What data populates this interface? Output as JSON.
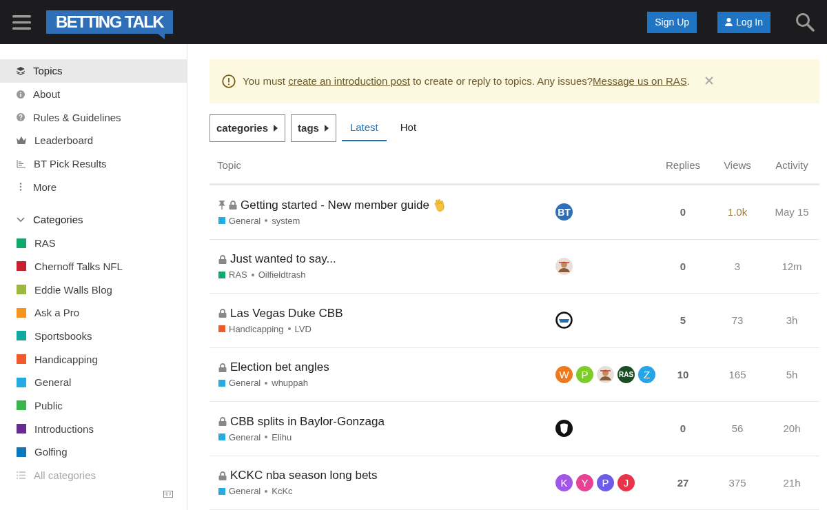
{
  "header": {
    "logo": "BETTING TALK",
    "buttons": [
      {
        "label": "Sign Up",
        "kind": "signup"
      },
      {
        "label": "Log In",
        "kind": "login"
      }
    ]
  },
  "sidebar": {
    "items": [
      {
        "label": "Topics",
        "selected": true
      },
      {
        "label": "About",
        "selected": false
      },
      {
        "label": "Rules & Guidelines",
        "selected": false
      },
      {
        "label": "Leaderboard",
        "selected": false
      },
      {
        "label": "BT Pick Results",
        "selected": false
      },
      {
        "label": "More",
        "selected": false
      }
    ],
    "categories_header": {
      "label": "Categories",
      "expanded": true
    },
    "categories": [
      {
        "label": "RAS",
        "color": "#12a86b"
      },
      {
        "label": "Chernoff Talks NFL",
        "color": "#c8202e"
      },
      {
        "label": "Eddie Walls Blog",
        "color": "#9eb83b"
      },
      {
        "label": "Ask a Pro",
        "color": "#f7941d"
      },
      {
        "label": "Sportsbooks",
        "color": "#12a89d"
      },
      {
        "label": "Handicapping",
        "color": "#f1592a"
      },
      {
        "label": "General",
        "color": "#25aae2"
      },
      {
        "label": "Public",
        "color": "#3ab54a"
      },
      {
        "label": "Introductions",
        "color": "#652d90"
      },
      {
        "label": "Golfing",
        "color": "#0e76bd"
      }
    ],
    "all_categories": "All categories"
  },
  "notice": {
    "parts": [
      {
        "kind": "text",
        "text": "You must "
      },
      {
        "kind": "link",
        "text": "create an introduction post"
      },
      {
        "kind": "text",
        "text": " to create or reply to topics. Any issues?"
      },
      {
        "kind": "link",
        "text": "Message us on RAS"
      },
      {
        "kind": "text",
        "text": "."
      }
    ]
  },
  "filters": {
    "dropdowns": [
      "categories",
      "tags"
    ],
    "tabs": [
      {
        "label": "Latest",
        "selected": true
      },
      {
        "label": "Hot",
        "selected": false
      }
    ]
  },
  "table": {
    "columns": [
      "Topic",
      "Replies",
      "Views",
      "Activity"
    ],
    "rows": [
      {
        "title": "Getting started - New member guide",
        "pinned": true,
        "wave": true,
        "category": {
          "label": "General",
          "color": "#25aae2"
        },
        "author": "system",
        "avatars": [
          {
            "kind": "letter",
            "text": "BT",
            "color": "#2f6fb8"
          }
        ],
        "replies": "0",
        "views": "1.0k",
        "hot": true,
        "activity": "May 15"
      },
      {
        "title": "Just wanted to say...",
        "pinned": false,
        "wave": false,
        "category": {
          "label": "RAS",
          "color": "#12a86b"
        },
        "author": "Oilfieldtrash",
        "avatars": [
          {
            "kind": "image"
          }
        ],
        "replies": "0",
        "views": "3",
        "hot": false,
        "activity": "12m"
      },
      {
        "title": "Las Vegas Duke CBB",
        "pinned": false,
        "wave": false,
        "category": {
          "label": "Handicapping",
          "color": "#f1592a"
        },
        "author": "LVD",
        "avatars": [
          {
            "kind": "ring"
          }
        ],
        "replies": "5",
        "views": "73",
        "hot": false,
        "activity": "3h"
      },
      {
        "title": "Election bet angles",
        "pinned": false,
        "wave": false,
        "category": {
          "label": "General",
          "color": "#25aae2"
        },
        "author": "whuppah",
        "avatars": [
          {
            "kind": "letter",
            "text": "W",
            "color": "#f0791f"
          },
          {
            "kind": "letter",
            "text": "P",
            "color": "#7ccc2a"
          },
          {
            "kind": "image"
          },
          {
            "kind": "letter",
            "text": "RAS",
            "color": "#1a4d23"
          },
          {
            "kind": "letter",
            "text": "Z",
            "color": "#25a5e6"
          }
        ],
        "replies": "10",
        "views": "165",
        "hot": false,
        "activity": "5h"
      },
      {
        "title": "CBB splits in Baylor-Gonzaga",
        "pinned": false,
        "wave": false,
        "category": {
          "label": "General",
          "color": "#25aae2"
        },
        "author": "Elihu",
        "avatars": [
          {
            "kind": "mask"
          }
        ],
        "replies": "0",
        "views": "56",
        "hot": false,
        "activity": "20h"
      },
      {
        "title": "KCKC nba season long bets",
        "pinned": false,
        "wave": false,
        "category": {
          "label": "General",
          "color": "#25aae2"
        },
        "author": "KcKc",
        "avatars": [
          {
            "kind": "letter",
            "text": "K",
            "color": "#a056e6"
          },
          {
            "kind": "letter",
            "text": "Y",
            "color": "#e84393"
          },
          {
            "kind": "letter",
            "text": "P",
            "color": "#6c5ce7"
          },
          {
            "kind": "letter",
            "text": "J",
            "color": "#e8344a"
          }
        ],
        "replies": "27",
        "views": "375",
        "hot": false,
        "activity": "21h"
      }
    ]
  }
}
